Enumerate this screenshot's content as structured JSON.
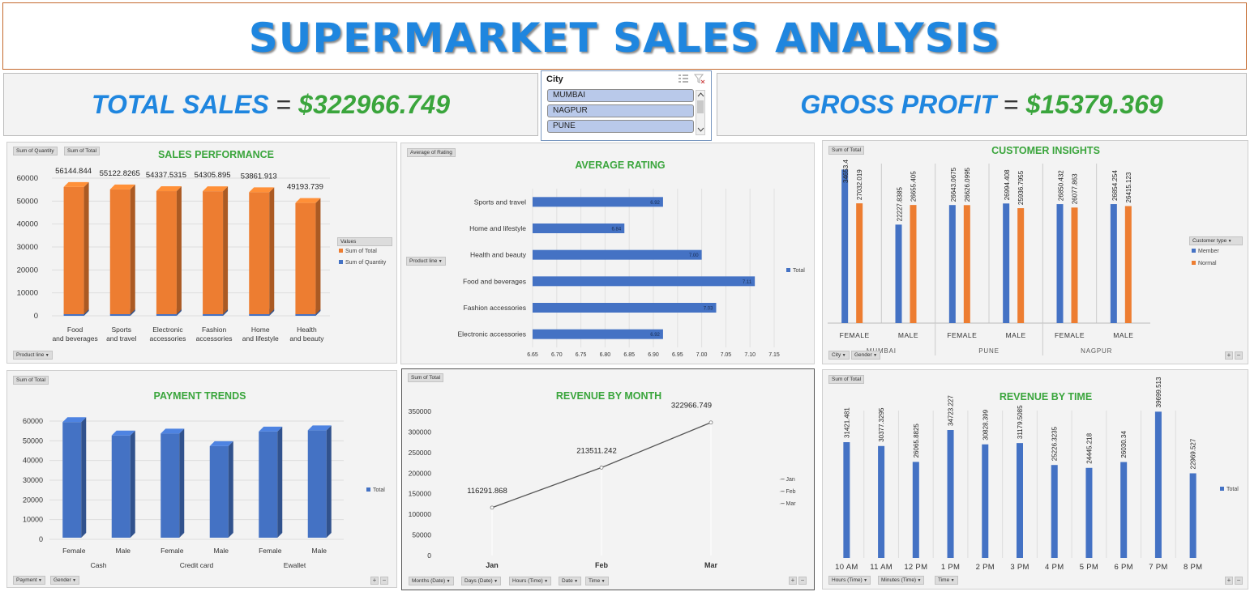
{
  "title": "SUPERMARKET SALES ANALYSIS",
  "kpis": {
    "total_sales": {
      "label": "TOTAL SALES",
      "eq": "=",
      "value": "$322966.749"
    },
    "gross_profit": {
      "label": "GROSS PROFIT",
      "eq": "=",
      "value": "$15379.369"
    }
  },
  "slicer": {
    "title": "City",
    "items": [
      "MUMBAI",
      "NAGPUR",
      "PUNE"
    ]
  },
  "colors": {
    "blue": "#4472c4",
    "orange": "#ed7d31",
    "green": "#3aa53c",
    "title_blue": "#1f86df"
  },
  "icons": {
    "multi_select": "multi-select-icon",
    "clear_filter": "clear-filter-icon",
    "scroll_up": "scroll-up-icon",
    "scroll_down": "scroll-down-icon"
  },
  "sales_performance": {
    "title": "SALES PERFORMANCE",
    "tags": [
      "Sum of Quantity",
      "Sum of Total"
    ],
    "field": "Product line",
    "legend_title": "Values",
    "legend": [
      "Sum of Total",
      "Sum of Quantity"
    ]
  },
  "average_rating": {
    "title": "AVERAGE RATING",
    "tag": "Average of Rating",
    "field": "Product line",
    "legend": [
      "Total"
    ]
  },
  "customer_insights": {
    "title": "CUSTOMER INSIGHTS",
    "tag": "Sum of Total",
    "legend_title": "Customer type",
    "legend": [
      "Member",
      "Normal"
    ],
    "fields": [
      "City",
      "Gender"
    ]
  },
  "payment_trends": {
    "title": "PAYMENT TRENDS",
    "tag": "Sum of Total",
    "legend": [
      "Total"
    ],
    "fields": [
      "Payment",
      "Gender"
    ]
  },
  "revenue_month": {
    "title": "REVENUE BY MONTH",
    "tag": "Sum of Total",
    "legend": [
      "Jan",
      "Feb",
      "Mar"
    ],
    "fields": [
      "Months (Date)",
      "Days (Date)",
      "Hours (Time)",
      "Date",
      "Time"
    ]
  },
  "revenue_time": {
    "title": "REVENUE BY TIME",
    "tag": "Sum of Total",
    "legend": [
      "Total"
    ],
    "fields": [
      "Hours (Time)",
      "Minutes (Time)",
      "Time"
    ]
  },
  "chart_data": [
    {
      "type": "bar",
      "title": "SALES PERFORMANCE",
      "categories": [
        "Food and beverages",
        "Sports and travel",
        "Electronic accessories",
        "Fashion accessories",
        "Home and lifestyle",
        "Health and beauty"
      ],
      "series": [
        {
          "name": "Sum of Total",
          "values": [
            56144.844,
            55122.8265,
            54337.5315,
            54305.895,
            53861.913,
            49193.739
          ]
        },
        {
          "name": "Sum of Quantity",
          "values": [
            952,
            920,
            971,
            902,
            911,
            854
          ]
        }
      ],
      "data_labels": [
        "56144.844",
        "55122.8265",
        "54337.5315",
        "54305.895",
        "53861.913",
        "49193.739"
      ],
      "ylim": [
        0,
        60000
      ],
      "yticks": [
        "0",
        "10000",
        "20000",
        "30000",
        "40000",
        "50000",
        "60000"
      ]
    },
    {
      "type": "bar",
      "title": "AVERAGE RATING",
      "orientation": "horizontal",
      "categories": [
        "Sports and travel",
        "Home and lifestyle",
        "Health and beauty",
        "Food and beverages",
        "Fashion accessories",
        "Electronic accessories"
      ],
      "series": [
        {
          "name": "Total",
          "values": [
            6.92,
            6.84,
            7.0,
            7.11,
            7.03,
            6.92
          ]
        }
      ],
      "data_labels": [
        "6.92",
        "6.84",
        "7.00",
        "7.11",
        "7.03",
        "6.92"
      ],
      "xlim": [
        6.65,
        7.15
      ],
      "xticks": [
        "6.65",
        "6.70",
        "6.75",
        "6.80",
        "6.85",
        "6.90",
        "6.95",
        "7.00",
        "7.05",
        "7.10",
        "7.15"
      ]
    },
    {
      "type": "bar",
      "title": "CUSTOMER INSIGHTS",
      "groups": [
        "MUMBAI",
        "PUNE",
        "NAGPUR"
      ],
      "categories": [
        "FEMALE",
        "MALE",
        "FEMALE",
        "MALE",
        "FEMALE",
        "MALE"
      ],
      "series": [
        {
          "name": "Member",
          "values": [
            34653.4,
            22227.8385,
            26643.0675,
            26994.408,
            26850.432,
            26854.254
          ]
        },
        {
          "name": "Normal",
          "values": [
            27032.019,
            26655.405,
            26626.0995,
            25936.7955,
            26077.863,
            26415.123
          ]
        }
      ],
      "labels": {
        "Member": [
          "34653.4",
          "22227.8385",
          "26643.0675",
          "26994.408",
          "26850.432",
          "26854.254"
        ],
        "Normal": [
          "27032.019",
          "26655.405",
          "26626.0995",
          "25936.7955",
          "26077.863",
          "26415.123"
        ]
      },
      "ylim": [
        0,
        36000
      ]
    },
    {
      "type": "bar",
      "title": "PAYMENT TRENDS",
      "groups": [
        "Cash",
        "Credit card",
        "Ewallet"
      ],
      "categories": [
        "Female",
        "Male",
        "Female",
        "Male",
        "Female",
        "Male"
      ],
      "series": [
        {
          "name": "Total",
          "values": [
            59500,
            52700,
            53700,
            47300,
            54700,
            55300
          ]
        }
      ],
      "ylim": [
        0,
        60000
      ],
      "yticks": [
        "0",
        "10000",
        "20000",
        "30000",
        "40000",
        "50000",
        "60000"
      ]
    },
    {
      "type": "line",
      "title": "REVENUE BY MONTH",
      "categories": [
        "Jan",
        "Feb",
        "Mar"
      ],
      "series": [
        {
          "name": "Total",
          "values": [
            116291.868,
            213511.242,
            322966.749
          ]
        }
      ],
      "data_labels": [
        "116291.868",
        "213511.242",
        "322966.749"
      ],
      "ylim": [
        0,
        350000
      ],
      "yticks": [
        "0",
        "50000",
        "100000",
        "150000",
        "200000",
        "250000",
        "300000",
        "350000"
      ]
    },
    {
      "type": "bar",
      "title": "REVENUE BY TIME",
      "categories": [
        "10 AM",
        "11 AM",
        "12 PM",
        "1 PM",
        "2 PM",
        "3 PM",
        "4 PM",
        "5 PM",
        "6 PM",
        "7 PM",
        "8 PM"
      ],
      "series": [
        {
          "name": "Total",
          "values": [
            31421.481,
            30377.3295,
            26065.8825,
            34723.227,
            30828.399,
            31179.5085,
            25226.3235,
            24445.218,
            26030.34,
            39699.513,
            22969.527
          ]
        }
      ],
      "data_labels": [
        "31421.481",
        "30377.3295",
        "26065.8825",
        "34723.227",
        "30828.399",
        "31179.5085",
        "25226.3235",
        "24445.218",
        "26030.34",
        "39699.513",
        "22969.527"
      ],
      "ylim": [
        0,
        40000
      ]
    }
  ]
}
